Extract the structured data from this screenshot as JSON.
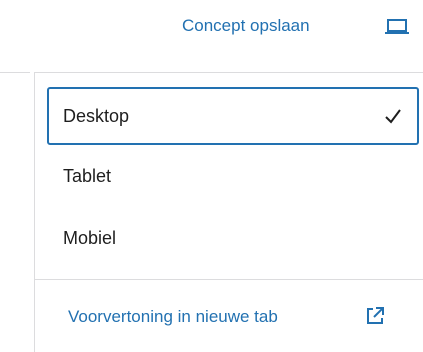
{
  "header": {
    "save_draft_label": "Concept opslaan",
    "device_icon": "laptop-icon"
  },
  "preview_menu": {
    "items": [
      {
        "label": "Desktop",
        "selected": true
      },
      {
        "label": "Tablet",
        "selected": false
      },
      {
        "label": "Mobiel",
        "selected": false
      }
    ],
    "check_icon": "check-icon",
    "preview_link_label": "Voorvertoning in nieuwe tab",
    "external_icon": "external-link-icon"
  },
  "colors": {
    "accent": "#2271b1",
    "text": "#1e1e1e",
    "divider": "#dcdcde"
  }
}
